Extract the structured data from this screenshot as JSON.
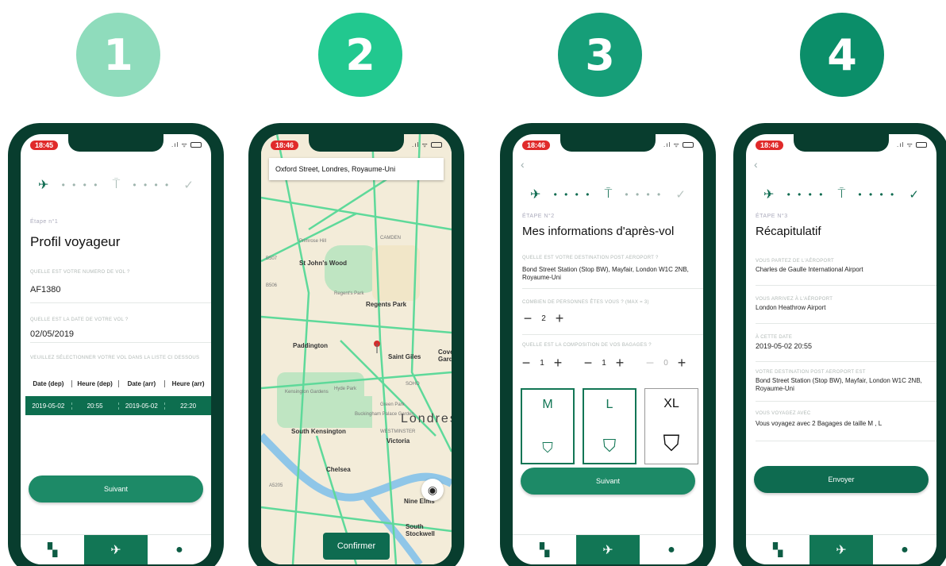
{
  "steps": [
    "1",
    "2",
    "3",
    "4"
  ],
  "status_time": "18:46",
  "phone1": {
    "status_time": "18:45",
    "step_label": "Étape n°1",
    "title": "Profil voyageur",
    "q_flight": "QUELLE EST VOTRE NUMERO DE VOL ?",
    "flight_value": "AF1380",
    "q_date": "QUELLE EST LA DATE DE VOTRE VOL ?",
    "date_value": "02/05/2019",
    "q_select": "VEUILLEZ SÉLECTIONNER VOTRE VOL DANS LA LISTE CI DESSOUS",
    "table_headers": [
      "Date (dep)",
      "Heure (dep)",
      "Date (arr)",
      "Heure (arr)"
    ],
    "table_row": [
      "2019-05-02",
      "20:55",
      "2019-05-02",
      "22:20"
    ],
    "button": "Suivant"
  },
  "phone2": {
    "search": "Oxford Street, Londres, Royaume-Uni",
    "places": [
      "Primrose Hill",
      "CAMDEN",
      "St John's Wood",
      "Regent's Park",
      "Regents Park",
      "Paddington",
      "Saint Giles",
      "Covent Garden",
      "Kensington Gardens",
      "Hyde Park",
      "Green Park",
      "Buckingham Palace Garden",
      "Londres",
      "WESTMINSTER",
      "Victoria",
      "South Kensington",
      "Chelsea",
      "Nine Elms",
      "South Stockwell",
      "SOHO",
      "B507",
      "B506",
      "A5205"
    ],
    "confirm": "Confirmer"
  },
  "phone3": {
    "step_label": "ÉTAPE N°2",
    "title": "Mes informations d'après-vol",
    "q_destination": "QUELLE EST VOTRE DESTINATION POST AEROPORT ?",
    "destination": "Bond Street Station (Stop BW), Mayfair, London W1C 2NB, Royaume-Uni",
    "q_people": "COMBIEN DE PERSONNES ÊTES VOUS ? (MAX = 3)",
    "people": "2",
    "q_bags": "QUELLE EST LA COMPOSITION DE VOS BAGAGES ?",
    "bag_counts": [
      "1",
      "1",
      "0"
    ],
    "bag_sizes": [
      "M",
      "L",
      "XL"
    ],
    "button": "Suivant"
  },
  "phone4": {
    "step_label": "ÉTAPE N°3",
    "title": "Récapitulatif",
    "l_departure": "VOUS PARTEZ DE L'AÉROPORT",
    "departure": "Charles de Gaulle International Airport",
    "l_arrival": "VOUS ARRIVEZ À L'AÉROPORT",
    "arrival": "London Heathrow Airport",
    "l_time": "À CETTE DATE",
    "time": "2019-05-02 20:55",
    "l_destination": "VOTRE DESTINATION POST AEROPORT EST",
    "destination": "Bond Street Station (Stop BW), Mayfair, London W1C 2NB, Royaume-Uni",
    "l_bags": "VOUS VOYAGEZ AVEC",
    "bags": "Vous voyagez avec 2 Bagages de taille M , L",
    "button": "Envoyer"
  },
  "icons": {
    "plane": "✈",
    "sign": "⍑",
    "check": "✓",
    "chat": "▚",
    "user": "●",
    "locate": "◉",
    "bag": "⛉"
  },
  "colors": {
    "phone_frame": "#083d2e",
    "accent": "#127655",
    "button": "#1d8a67",
    "step1": "#8fdcbc",
    "step2": "#22c88f",
    "step3": "#169e78",
    "step4": "#0b8e69"
  }
}
